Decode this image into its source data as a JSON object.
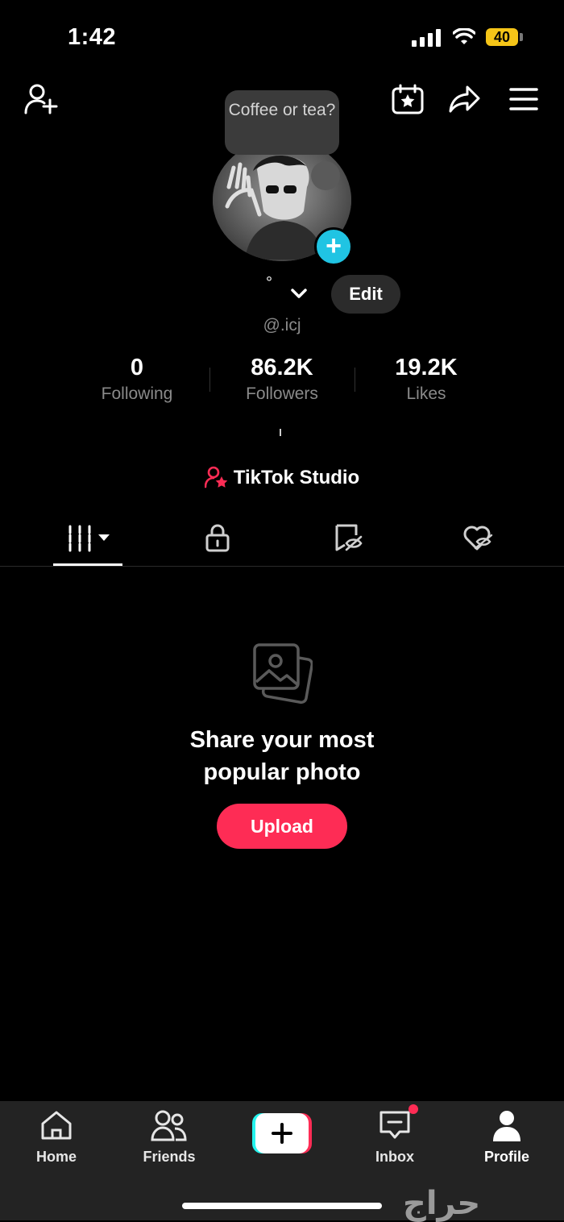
{
  "status_bar": {
    "time": "1:42",
    "battery": "40"
  },
  "profile": {
    "note_bubble": "Coffee or tea?",
    "name": "°",
    "handle": "@.icj",
    "edit_label": "Edit"
  },
  "stats": [
    {
      "value": "0",
      "label": "Following"
    },
    {
      "value": "86.2K",
      "label": "Followers"
    },
    {
      "value": "19.2K",
      "label": "Likes"
    }
  ],
  "studio_label": "TikTok Studio",
  "tabs": [
    "grid-tab",
    "private-tab",
    "hidden-tab",
    "liked-tab"
  ],
  "empty_state": {
    "title_line1": "Share your most",
    "title_line2": "popular photo",
    "upload_label": "Upload"
  },
  "nav": [
    {
      "label": "Home",
      "icon": "home-icon"
    },
    {
      "label": "Friends",
      "icon": "friends-icon"
    },
    {
      "label": "",
      "icon": "create-icon"
    },
    {
      "label": "Inbox",
      "icon": "inbox-icon"
    },
    {
      "label": "Profile",
      "icon": "profile-icon"
    }
  ],
  "watermark": "حراج",
  "colors": {
    "accent": "#fe2c55",
    "add_badge": "#20c4e3",
    "battery": "#f5c518"
  }
}
